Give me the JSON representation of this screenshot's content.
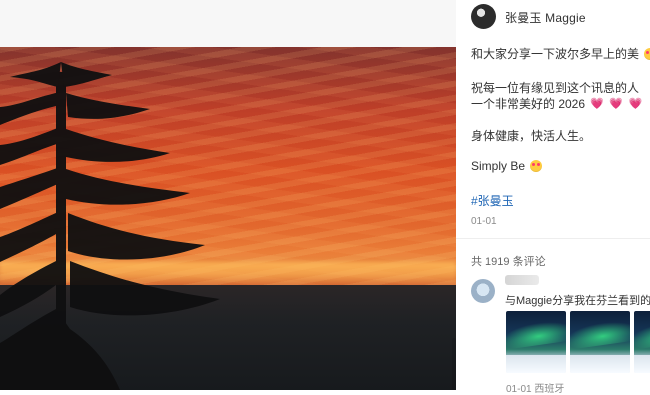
{
  "post": {
    "author": "张曼玉 Maggie",
    "line1": "和大家分享一下波尔多早上的美",
    "line2": "祝每一位有缘见到这个讯息的人",
    "line3": "一个非常美好的 2026",
    "line4": "身体健康，快活人生。",
    "line5": "Simply Be",
    "hashtag": "#张曼玉",
    "date": "01-01",
    "emoji_face": "😍",
    "emoji_heart": "💗"
  },
  "comments": {
    "count_label": "共 1919 条评论",
    "first": {
      "text": "与Maggie分享我在芬兰看到的极光",
      "meta": "01-01 西班牙"
    }
  },
  "colors": {
    "link": "#1f66b5",
    "text": "#333333",
    "muted": "#8a8a8a"
  }
}
